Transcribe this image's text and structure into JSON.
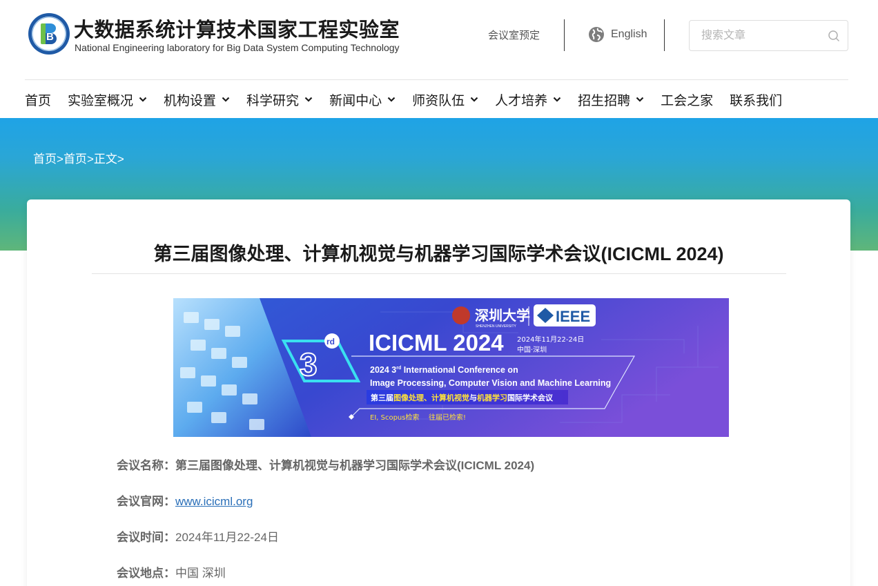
{
  "header": {
    "logo_letter": "B",
    "title": "大数据系统计算技术国家工程实验室",
    "subtitle": "National Engineering laboratory for Big Data System Computing Technology",
    "booking_link": "会议室预定",
    "language_link": "English",
    "search_placeholder": "搜索文章"
  },
  "nav": [
    {
      "label": "首页",
      "dropdown": false
    },
    {
      "label": "实验室概况",
      "dropdown": true
    },
    {
      "label": "机构设置",
      "dropdown": true
    },
    {
      "label": "科学研究",
      "dropdown": true
    },
    {
      "label": "新闻中心",
      "dropdown": true
    },
    {
      "label": "师资队伍",
      "dropdown": true
    },
    {
      "label": "人才培养",
      "dropdown": true
    },
    {
      "label": "招生招聘",
      "dropdown": true
    },
    {
      "label": "工会之家",
      "dropdown": false
    },
    {
      "label": "联系我们",
      "dropdown": false
    }
  ],
  "breadcrumb": {
    "items": [
      "首页",
      "首页",
      "正文"
    ],
    "separator": ">"
  },
  "article": {
    "title": "第三届图像处理、计算机视觉与机器学习国际学术会议(ICICML 2024)",
    "poster": {
      "logo_szu_cn": "深圳大学",
      "logo_szu_en": "SHENZHEN UNIVERSITY",
      "logo_ieee": "IEEE",
      "edition_number": "3",
      "edition_suffix": "rd",
      "conf_name": "ICICML 2024",
      "date": "2024年11月22-24日",
      "place": "中国·深圳",
      "en_line1_prefix": "2024 3",
      "en_line1_sup": "rd",
      "en_line1_rest": " International Conference on",
      "en_line2": "Image Processing, Computer Vision and Machine Learning",
      "cn_line_prefix": "第三届",
      "cn_line_highlight": "图像处理、计算机视觉",
      "cn_line_mid": "与",
      "cn_line_highlight2": "机器学习",
      "cn_line_suffix": "国际学术会议",
      "index_note1": "EI, Scopus检索",
      "index_note2": "往届已检索!"
    },
    "fields": [
      {
        "key": "会议名称：",
        "value": "第三届图像处理、计算机视觉与机器学习国际学术会议(ICICML 2024)",
        "type": "bold"
      },
      {
        "key": "会议官网：",
        "value": "www.icicml.org",
        "type": "link"
      },
      {
        "key": "会议时间：",
        "value": "2024年11月22-24日",
        "type": "text"
      },
      {
        "key": "会议地点：",
        "value": "中国 深圳",
        "type": "text"
      }
    ]
  },
  "colors": {
    "banner_top": "#1fa3e6",
    "banner_bottom": "#5fb67a",
    "link": "#2a6fb8",
    "poster_bg_dark": "#3a3fc9",
    "poster_bg_light": "#7c4fd8",
    "poster_accent": "#3ae0f0",
    "poster_highlight": "#ffe23a"
  }
}
